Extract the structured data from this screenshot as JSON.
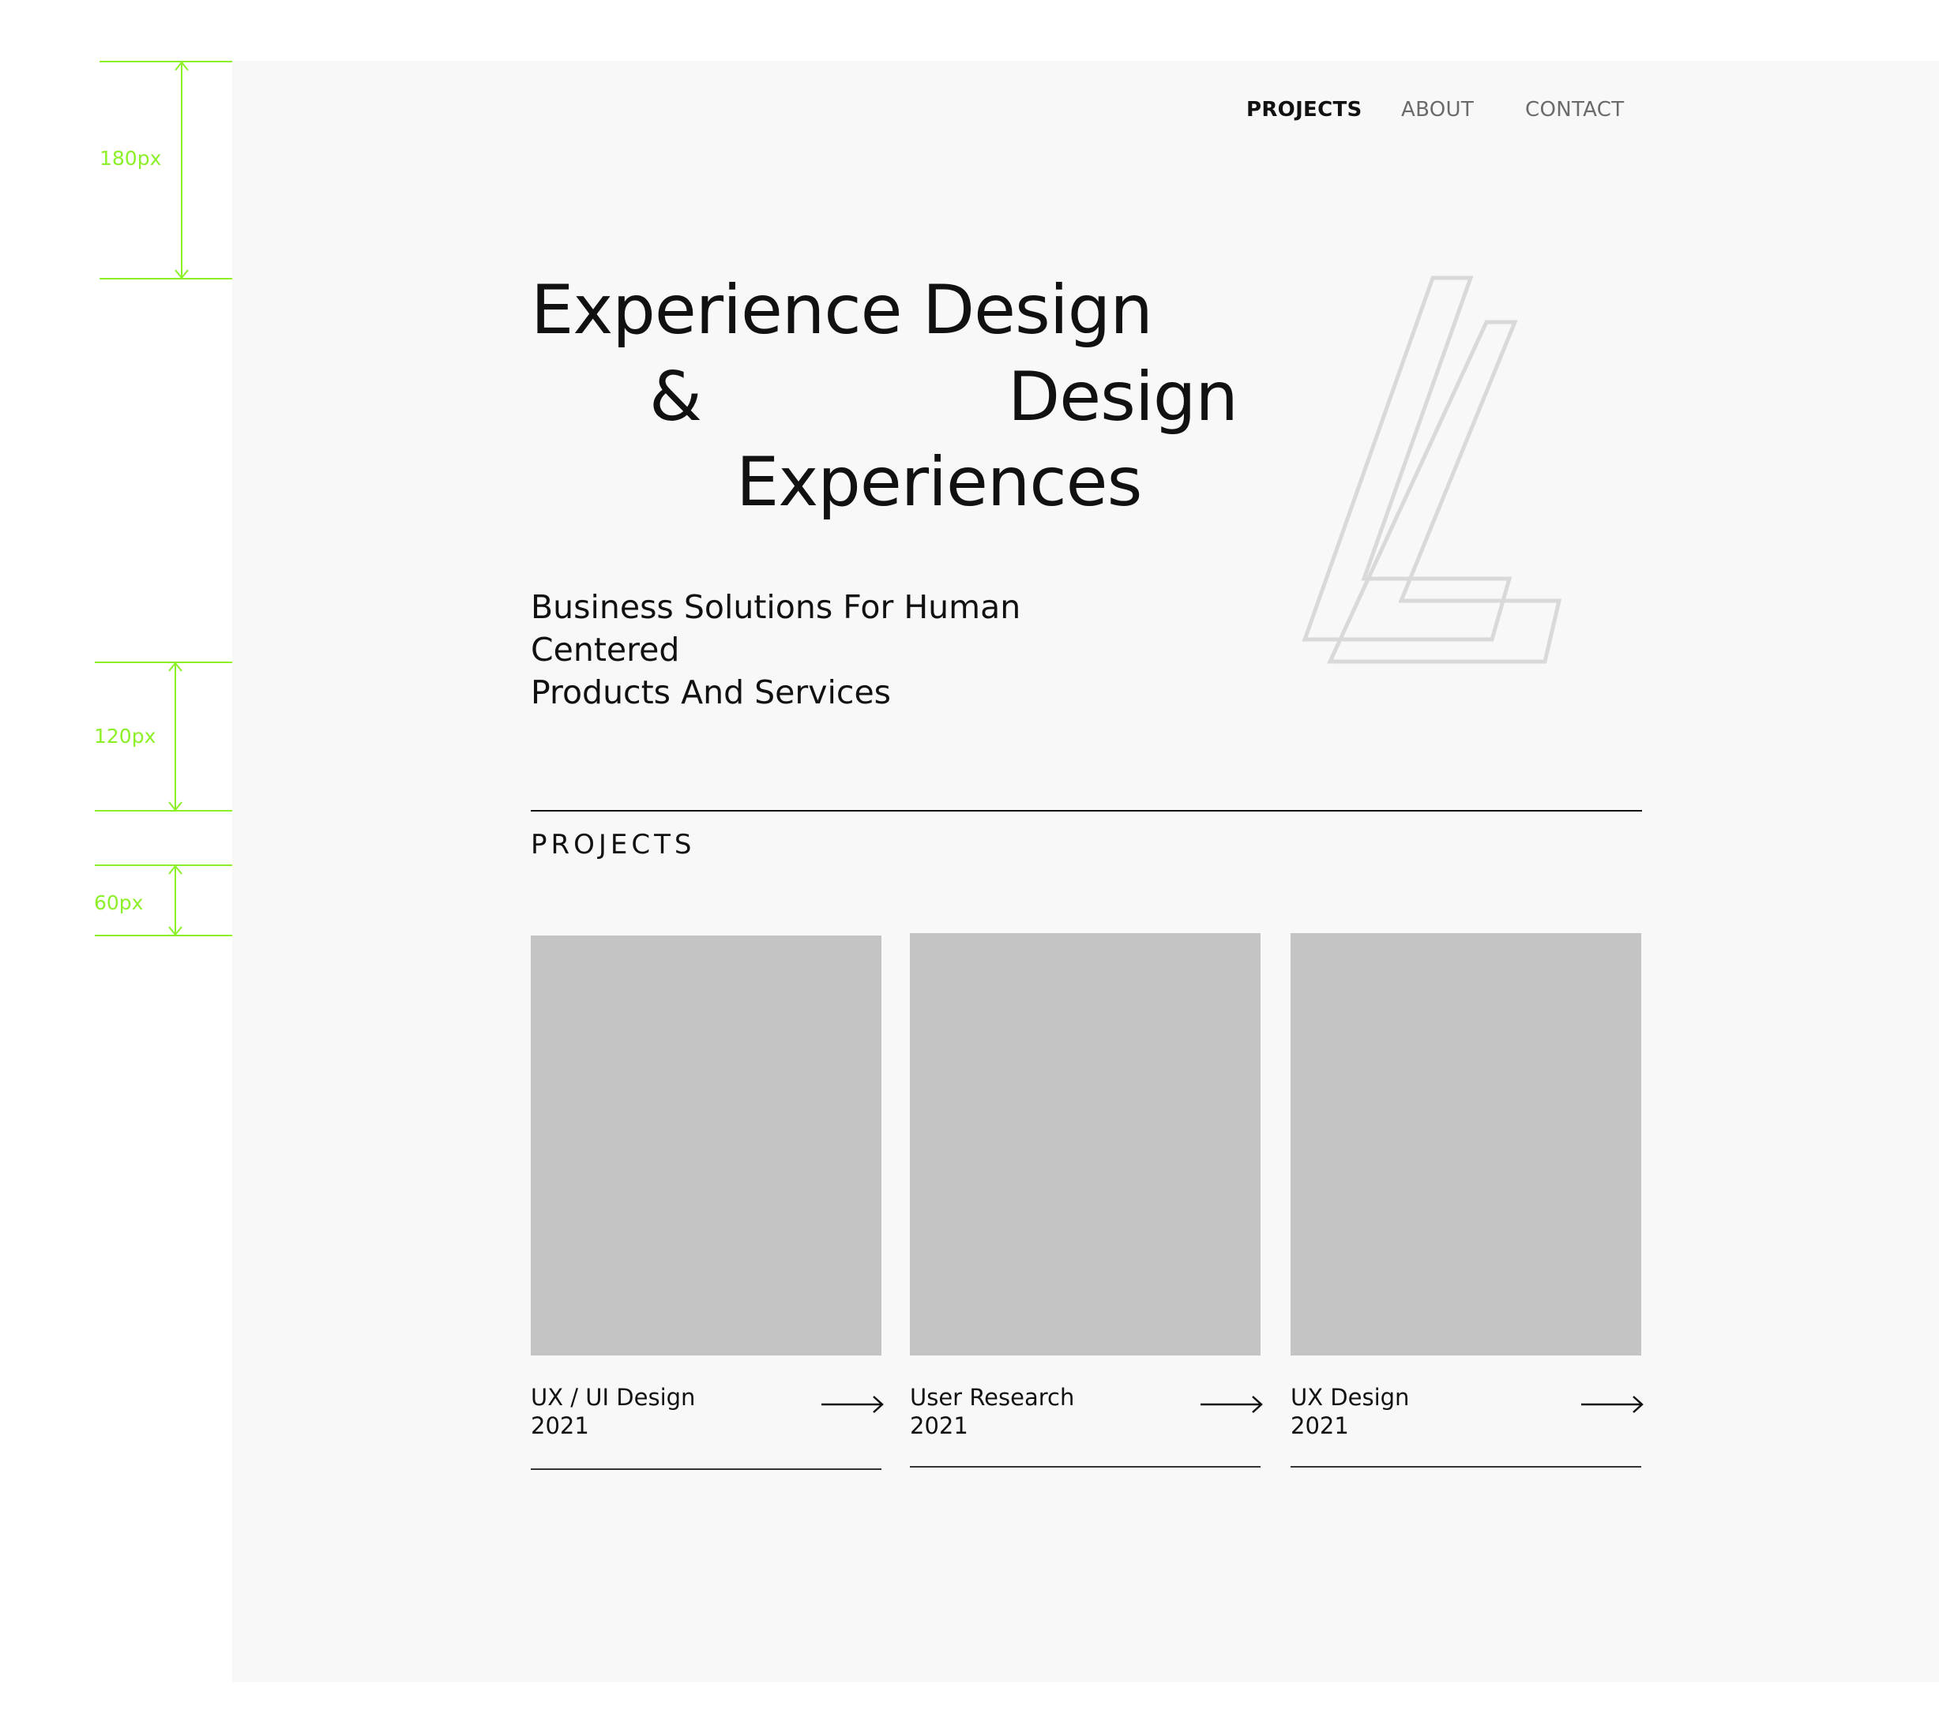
{
  "nav": {
    "items": [
      {
        "label": "PROJECTS",
        "active": true
      },
      {
        "label": "ABOUT",
        "active": false
      },
      {
        "label": "CONTACT",
        "active": false
      }
    ]
  },
  "hero": {
    "title_line1": "Experience Design",
    "title_amp": "&",
    "title_design": "Design",
    "title_line3": "Experiences",
    "subtitle_line1": "Business Solutions For Human Centered",
    "subtitle_line2": "Products And Services",
    "logo_icon": "outlined-letter-l-logo-icon"
  },
  "projects": {
    "section_title": "PROJECTS",
    "cards": [
      {
        "name": "UX / UI Design",
        "year": "2021",
        "arrow_icon": "arrow-right-icon"
      },
      {
        "name": "User Research",
        "year": "2021",
        "arrow_icon": "arrow-right-icon"
      },
      {
        "name": "UX Design",
        "year": "2021",
        "arrow_icon": "arrow-right-icon"
      }
    ]
  },
  "annotations": {
    "top_spacing_label": "180px",
    "hero_spacing_label": "120px",
    "section_spacing_label": "60px",
    "color": "#8cf028"
  },
  "colors": {
    "page_background": "#f8f8f8",
    "thumbnail_placeholder": "#c4c4c4",
    "text": "#111111",
    "logo_stroke": "#d9d9d9"
  }
}
